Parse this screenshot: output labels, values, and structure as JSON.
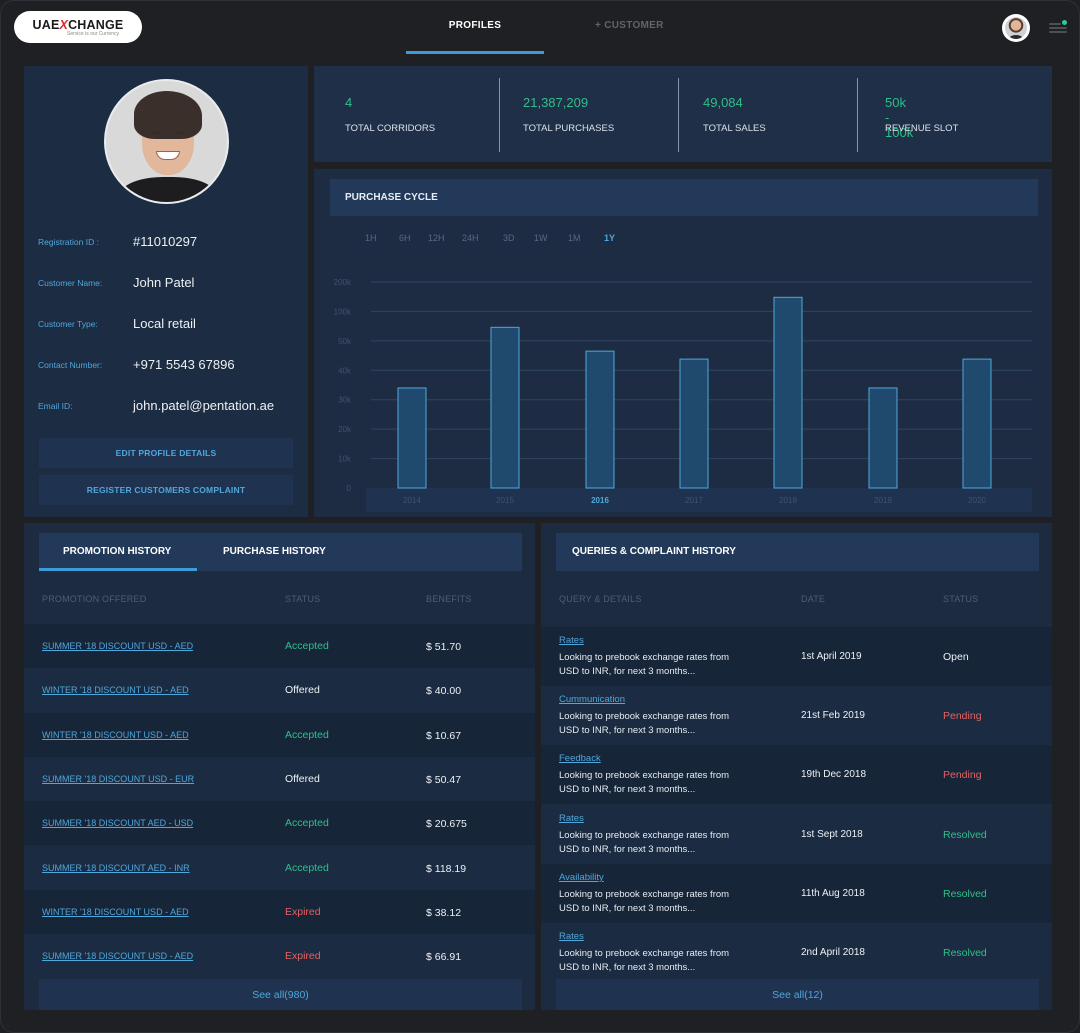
{
  "header": {
    "logo_text_left": "UAE",
    "logo_text_x": "X",
    "logo_text_right": "CHANGE",
    "logo_tagline": "Service is our Currency",
    "tabs": [
      {
        "label": "PROFILES",
        "active": true
      },
      {
        "label": "+ CUSTOMER",
        "active": false
      }
    ],
    "notification_color": "#2ecc8f"
  },
  "profile": {
    "fields": [
      {
        "label": "Registration ID :",
        "value": "#11010297"
      },
      {
        "label": "Customer Name:",
        "value": "John Patel"
      },
      {
        "label": "Customer Type:",
        "value": "Local retail"
      },
      {
        "label": "Contact Number:",
        "value": "+971 5543 67896"
      },
      {
        "label": "Email ID:",
        "value": "john.patel@pentation.ae"
      }
    ],
    "edit_button": "EDIT PROFILE DETAILS",
    "complaint_button": "REGISTER CUSTOMERS COMPLAINT"
  },
  "stats": [
    {
      "value": "4",
      "label": "TOTAL CORRIDORS"
    },
    {
      "value": "21,387,209",
      "label": "TOTAL PURCHASES"
    },
    {
      "value": "49,084",
      "label": "TOTAL SALES"
    },
    {
      "value": "50k - 100k",
      "label": "REVENUE SLOT"
    }
  ],
  "purchase_cycle": {
    "title": "PURCHASE CYCLE",
    "ranges": [
      "1H",
      "6H",
      "12H",
      "24H",
      "3D",
      "1W",
      "1M",
      "1Y"
    ],
    "active_range": "1Y"
  },
  "chart_data": {
    "type": "bar",
    "title": "PURCHASE CYCLE",
    "categories": [
      "2014",
      "2015",
      "2016",
      "2017",
      "2018",
      "2019",
      "2020"
    ],
    "values": [
      34000,
      73000,
      46500,
      43800,
      148000,
      34000,
      43800
    ],
    "highlighted_category": "2016",
    "y_ticks": [
      "0",
      "10k",
      "20k",
      "30k",
      "40k",
      "50k",
      "100k",
      "200k"
    ],
    "y_tick_values": [
      0,
      10000,
      20000,
      30000,
      40000,
      50000,
      100000,
      200000
    ],
    "ylim": [
      0,
      200000
    ],
    "xlabel": "",
    "ylabel": "",
    "grid": true,
    "colors": {
      "bar_fill": "#1f4a6e",
      "bar_stroke": "#4fa7dc",
      "grid": "#2f4661"
    }
  },
  "promotion": {
    "tabs": [
      {
        "label": "PROMOTION HISTORY",
        "active": true
      },
      {
        "label": "PURCHASE HISTORY",
        "active": false
      }
    ],
    "columns": [
      "PROMOTION OFFERED",
      "STATUS",
      "BENEFITS"
    ],
    "rows": [
      {
        "promotion": "SUMMER '18 DISCOUNT USD - AED",
        "status": "Accepted",
        "benefit": "$ 51.70"
      },
      {
        "promotion": "WINTER '18 DISCOUNT USD - AED",
        "status": "Offered",
        "benefit": "$ 40.00"
      },
      {
        "promotion": "WINTER '18 DISCOUNT USD - AED",
        "status": "Accepted",
        "benefit": "$ 10.67"
      },
      {
        "promotion": "SUMMER '18 DISCOUNT USD - EUR",
        "status": "Offered",
        "benefit": "$ 50.47"
      },
      {
        "promotion": "SUMMER '18 DISCOUNT AED - USD",
        "status": "Accepted",
        "benefit": "$ 20.675"
      },
      {
        "promotion": "SUMMER '18 DISCOUNT AED - INR",
        "status": "Accepted",
        "benefit": "$ 118.19"
      },
      {
        "promotion": "WINTER '18 DISCOUNT USD - AED",
        "status": "Expired",
        "benefit": "$ 38.12"
      },
      {
        "promotion": "SUMMER '18 DISCOUNT USD - AED",
        "status": "Expired",
        "benefit": "$ 66.91"
      }
    ],
    "see_all": "See all(980)"
  },
  "queries": {
    "title": "QUERIES & COMPLAINT HISTORY",
    "columns": [
      "QUERY & DETAILS",
      "DATE",
      "STATUS"
    ],
    "rows": [
      {
        "category": "Rates",
        "details": "Looking to prebook exchange rates from USD to INR, for next 3 months...",
        "date": "1st April 2019",
        "status": "Open"
      },
      {
        "category": "Cummunication",
        "details": "Looking to prebook exchange rates from USD to INR, for next 3 months...",
        "date": "21st Feb 2019",
        "status": "Pending"
      },
      {
        "category": "Feedback",
        "details": "Looking to prebook exchange rates from USD to INR, for next 3 months...",
        "date": "19th Dec 2018",
        "status": "Pending"
      },
      {
        "category": "Rates",
        "details": "Looking to prebook exchange rates from USD to INR, for next 3 months...",
        "date": "1st Sept 2018",
        "status": "Resolved"
      },
      {
        "category": "Availability",
        "details": "Looking to prebook exchange rates from USD to INR, for next 3 months...",
        "date": "11th Aug 2018",
        "status": "Resolved"
      },
      {
        "category": "Rates",
        "details": "Looking to prebook exchange rates from USD to INR, for next 3 months...",
        "date": "2nd April 2018",
        "status": "Resolved"
      }
    ],
    "see_all": "See all(12)"
  },
  "status_colors": {
    "Accepted": "#2fbf8a",
    "Resolved": "#2fbf8a",
    "Expired": "#e36262",
    "Pending": "#e36262",
    "Offered": "#eef1f4",
    "Open": "#eef1f4"
  }
}
